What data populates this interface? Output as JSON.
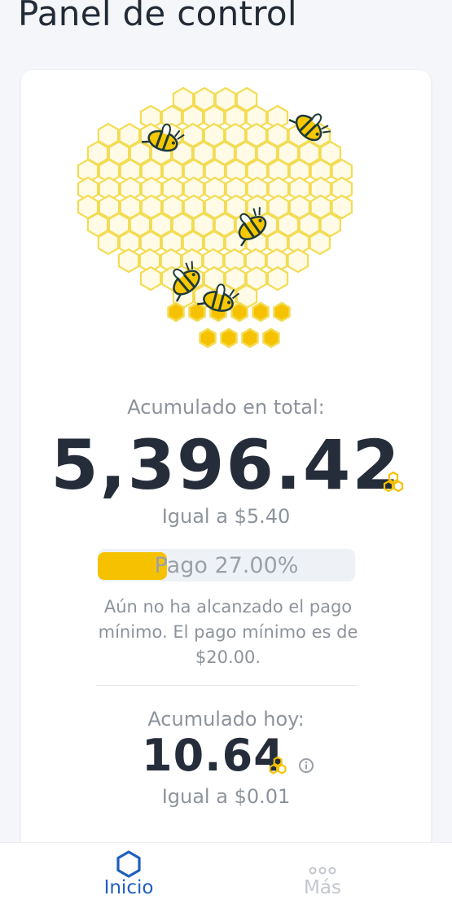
{
  "header": {
    "title": "Panel de control"
  },
  "summary": {
    "accumulated_label": "Acumulado en total:",
    "total_value": "5,396.42",
    "total_equal": "Igual a $5.40",
    "payout_label": "Pago 27.00%",
    "payout_progress": 0.27,
    "min_note": "Aún no ha alcanzado el pago mínimo. El pago mínimo es de $20.00.",
    "today_label": "Acumulado hoy:",
    "today_value": "10.64",
    "today_equal": "Igual a $0.01"
  },
  "colors": {
    "accent": "#f6c200",
    "nav_active": "#1f5fbf",
    "text_dark": "#262d3a",
    "text_muted": "#8d939c"
  },
  "icons": {
    "coin": "honeycomb-coin-icon",
    "info": "info-icon",
    "home": "hexagon-home-icon",
    "more": "more-dots-icon"
  },
  "tabbar": {
    "home_label": "Inicio",
    "more_label": "Más"
  }
}
